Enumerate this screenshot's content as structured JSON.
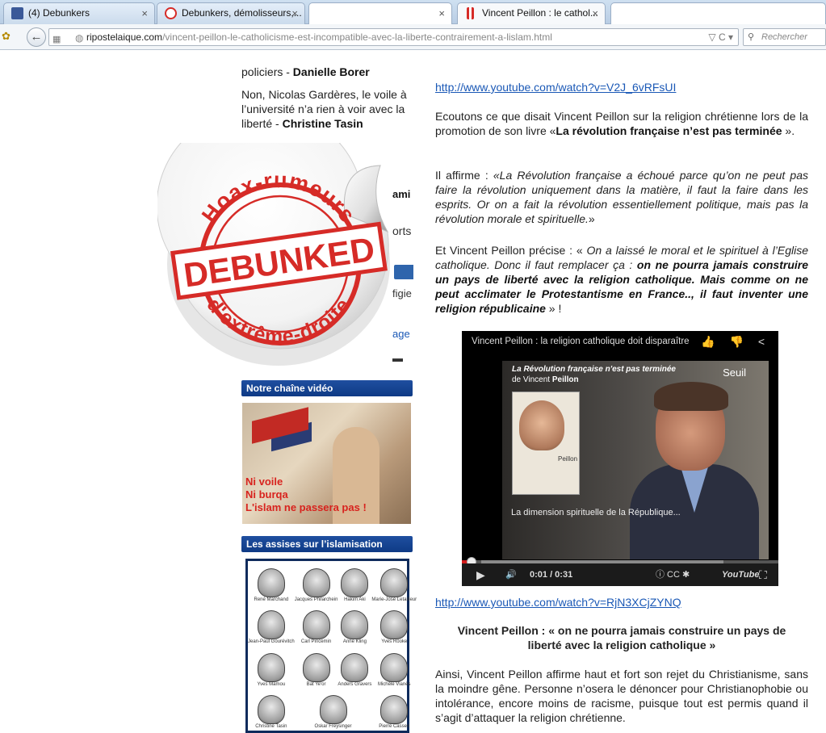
{
  "browser": {
    "tabs": [
      {
        "label": "(4) Debunkers",
        "icon": "facebook-icon"
      },
      {
        "label": "Debunkers, démolisseurs,...",
        "icon": "site-icon"
      },
      {
        "label": "",
        "icon": ""
      },
      {
        "label": "Vincent Peillon : le cathol...",
        "icon": "page-icon"
      },
      {
        "label": "",
        "icon": ""
      }
    ],
    "close_glyph": "×",
    "back_glyph": "←",
    "url_host": "ripostelaique.com",
    "url_path": "/vincent-peillon-le-catholicisme-est-incompatible-avec-la-liberte-contrairement-a-lislam.html",
    "url_controls": "▽ C ▾",
    "search_placeholder": "Rechercher",
    "colors": {
      "facebook": "#3b5998",
      "site_red": "#d62b27",
      "link": "#1a58b6",
      "header_blue": "#1f4fa0"
    }
  },
  "sidebar": {
    "line1_text": "policiers - ",
    "line1_author": "Danielle Borer",
    "item2_line1": "Non, Nicolas Gardères, le voile à",
    "item2_line2": "l’université n’a rien à voir avec la",
    "item2_line3": "liberté - ",
    "item2_author": "Christine Tasin",
    "clip_ami": "ami",
    "clip_orts": "orts",
    "clip_figie": "figie",
    "clip_age": "age",
    "clip_arrow": "▬",
    "video_section_title": "Notre chaîne vidéo",
    "video_overlay": [
      "Ni voile",
      "Ni burqa",
      "L'islam ne passera pas !"
    ],
    "assises_title": "Les assises sur l’islamisation",
    "portraits": [
      "René Marchand",
      "Jacques Philarchein",
      "Hakim Aki",
      "Marie-José Letailleur",
      "Jean-Paul Gourévitch",
      "Carl Pincemin",
      "Anne Kling",
      "Yves Rooke",
      "Yves Mamou",
      "Bat Ye'or",
      "Anders Gravers",
      "Michèle Vianès",
      "Christine Tasin",
      "Oskar Freysinger",
      "",
      "Pierre Cassen"
    ]
  },
  "sticker": {
    "arc_top": "Hoax-rumeurs",
    "stamp": "DEBUNKED",
    "arc_bottom": "d'extrême-droite"
  },
  "article": {
    "link1": "http://www.youtube.com/watch?v=V2J_6vRFsUI",
    "p1_a": "Ecoutons ce que disait Vincent Peillon  sur la religion chrétienne lors de la promotion de son livre «",
    "p1_bold": "La révolution française n’est pas terminée",
    "p1_b": " ».",
    "p2_a": "Il affirme : ",
    "p2_italic": "«La Révolution française a échoué parce qu’on ne peut pas faire la révolution uniquement dans la matière, il faut la faire dans les esprits. Or on a fait la révolution essentiellement politique, mais pas la révolution morale et spirituelle.",
    "p2_b": "»",
    "p3_a": "Et Vincent Peillon précise  : « ",
    "p3_italic": "On a laissé le moral et le spirituel à l’Eglise catholique. Donc il faut remplacer ça : ",
    "p3_bolditalic": "on ne pourra jamais construire un pays de liberté avec la religion catholique. Mais comme on ne peut acclimater le Protestantisme en France.., il faut inventer une religion républicaine",
    "p3_b": " » !",
    "link2": "http://www.youtube.com/watch?v=RjN3XCjZYNQ",
    "heading": "Vincent Peillon : « on ne pourra jamais construire un pays de liberté avec la religion catholique »",
    "p4": "Ainsi, Vincent Peillon affirme haut et fort son rejet du Christianisme, sans la moindre gêne. Personne n’osera le dénoncer pour Christianophobie ou intolérance, encore moins de racisme, puisque  tout est permis quand il s’agit d’attaquer la religion chrétienne."
  },
  "player": {
    "title": "Vincent Peillon : la religion catholique doit disparaître",
    "top_icons": "👍 👎 <",
    "book_title": "La Révolution française n'est pas terminée",
    "book_author_prefix": "de Vincent ",
    "book_author_name": "Peillon",
    "publisher": "Seuil",
    "book_cover_text": "Peillon",
    "caption": "La dimension spirituelle de la République...",
    "time": "0:01 / 0:31",
    "progress": 0.03,
    "play_glyph": "▶",
    "volume_glyph": "🔊",
    "ctrl_icons": "ⓘ  CC  ✱",
    "youtube_label": "YouTube",
    "fullscreen_glyph": "⛶"
  }
}
